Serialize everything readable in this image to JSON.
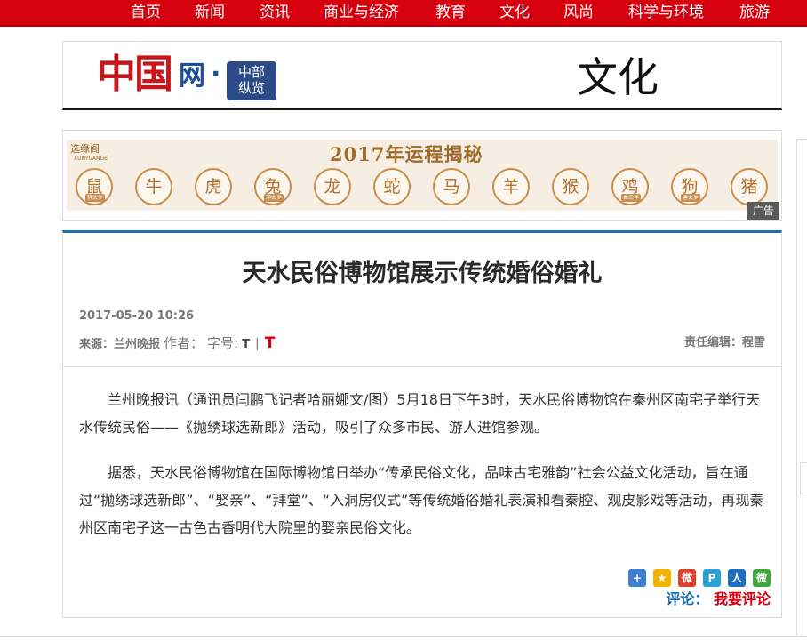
{
  "nav": {
    "items": [
      "首页",
      "新闻",
      "资讯",
      "商业与经济",
      "教育",
      "文化",
      "风尚",
      "科学与环境",
      "旅游"
    ],
    "bg_color": "#d6000f"
  },
  "header": {
    "logo_china": "中国",
    "logo_wang": "网",
    "logo_dot": "·",
    "logo_seal_line1": "中部",
    "logo_seal_line2": "纵览",
    "channel": "文化"
  },
  "ad": {
    "brand": "选缘阁",
    "brand_sub": "XUNYUANGE",
    "title": "2017年运程揭秘",
    "zodiac": [
      {
        "name": "鼠",
        "tag": "桃太岁"
      },
      {
        "name": "牛",
        "tag": ""
      },
      {
        "name": "虎",
        "tag": ""
      },
      {
        "name": "兔",
        "tag": "冲太岁"
      },
      {
        "name": "龙",
        "tag": ""
      },
      {
        "name": "蛇",
        "tag": ""
      },
      {
        "name": "马",
        "tag": ""
      },
      {
        "name": "羊",
        "tag": ""
      },
      {
        "name": "猴",
        "tag": ""
      },
      {
        "name": "鸡",
        "tag": "本命年"
      },
      {
        "name": "狗",
        "tag": "害太岁"
      },
      {
        "name": "猪",
        "tag": ""
      }
    ],
    "label": "广告"
  },
  "article": {
    "title": "天水民俗博物馆展示传统婚俗婚礼",
    "date": "2017-05-20 10:26",
    "source": "来源：兰州晚报",
    "author": "作者：",
    "font_size_label": "字号:",
    "font_small": "T",
    "separator": "|",
    "font_large": "T",
    "editor": "责任编辑：程雪",
    "paragraphs": [
      "兰州晚报讯（通讯员闫鹏飞记者哈丽娜文/图）5月18日下午3时，天水民俗博物馆在秦州区南宅子举行天水传统民俗——《抛绣球选新郎》活动，吸引了众多市民、游人进馆参观。",
      "据悉，天水民俗博物馆在国际博物馆日举办“传承民俗文化，品味古宅雅韵”社会公益文化活动，旨在通过“抛绣球选新郎”、“娶亲”、“拜堂”、“入洞房仪式”等传统婚俗婚礼表演和看秦腔、观皮影戏等活动，再现秦州区南宅子这一古色古香明代大院里的娶亲民俗文化。"
    ],
    "share_icons": [
      {
        "name": "share-more-icon",
        "glyph": "+",
        "color": "#3d7fd0"
      },
      {
        "name": "qzone-icon",
        "glyph": "★",
        "color": "#f0b400"
      },
      {
        "name": "weibo-icon",
        "glyph": "微",
        "color": "#e2402b"
      },
      {
        "name": "tencent-weibo-icon",
        "glyph": "P",
        "color": "#2aa2d6"
      },
      {
        "name": "renren-icon",
        "glyph": "人",
        "color": "#1e6fc1"
      },
      {
        "name": "wechat-icon",
        "glyph": "微",
        "color": "#3aa83a"
      }
    ],
    "comment_label": "评论：",
    "comment_link": "我要评论"
  }
}
